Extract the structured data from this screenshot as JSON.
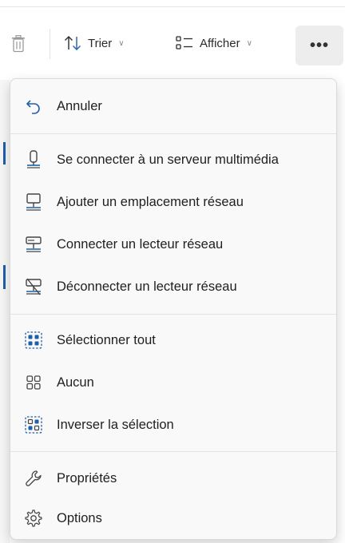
{
  "toolbar": {
    "sort_label": "Trier",
    "view_label": "Afficher",
    "more_label": "•••"
  },
  "menu": {
    "items": [
      {
        "label": "Annuler",
        "icon": "undo-icon"
      },
      {
        "label": "Se connecter à un serveur multimédia",
        "icon": "media-server-icon"
      },
      {
        "label": "Ajouter un emplacement réseau",
        "icon": "network-location-icon"
      },
      {
        "label": "Connecter un lecteur réseau",
        "icon": "map-network-drive-icon"
      },
      {
        "label": "Déconnecter un lecteur réseau",
        "icon": "disconnect-network-drive-icon"
      },
      {
        "label": "Sélectionner tout",
        "icon": "select-all-icon"
      },
      {
        "label": "Aucun",
        "icon": "select-none-icon"
      },
      {
        "label": "Inverser la sélection",
        "icon": "invert-selection-icon"
      },
      {
        "label": "Propriétés",
        "icon": "properties-icon"
      },
      {
        "label": "Options",
        "icon": "options-icon"
      }
    ]
  },
  "colors": {
    "accent": "#1f5fa9",
    "menu_bg": "#f9f9f9",
    "text": "#1f1f1f"
  }
}
